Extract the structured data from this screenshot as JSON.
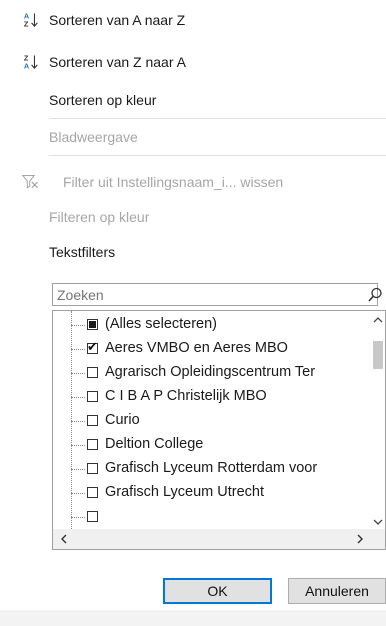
{
  "menu": {
    "sort_az": "Sorteren van A naar Z",
    "sort_za": "Sorteren van Z naar A",
    "sort_color": "Sorteren op kleur",
    "sheet_view": "Bladweergave",
    "clear_filter": "Filter uit Instellingsnaam_i... wissen",
    "filter_color": "Filteren op kleur",
    "text_filters": "Tekstfilters"
  },
  "search": {
    "placeholder": "Zoeken"
  },
  "list": {
    "items": [
      {
        "label": "(Alles selecteren)",
        "state": "indeterminate"
      },
      {
        "label": "Aeres VMBO en Aeres MBO",
        "state": "checked"
      },
      {
        "label": "Agrarisch Opleidingscentrum Ter",
        "state": "unchecked"
      },
      {
        "label": "C I B A P Christelijk MBO",
        "state": "unchecked"
      },
      {
        "label": "Curio",
        "state": "unchecked"
      },
      {
        "label": "Deltion College",
        "state": "unchecked"
      },
      {
        "label": "Grafisch Lyceum Rotterdam voor",
        "state": "unchecked"
      },
      {
        "label": "Grafisch Lyceum Utrecht",
        "state": "unchecked"
      }
    ]
  },
  "buttons": {
    "ok": "OK",
    "cancel": "Annuleren"
  },
  "icons": {
    "sort_az": "sort-ascending-icon",
    "sort_za": "sort-descending-icon",
    "clear_filter": "clear-filter-icon",
    "search": "search-icon"
  }
}
